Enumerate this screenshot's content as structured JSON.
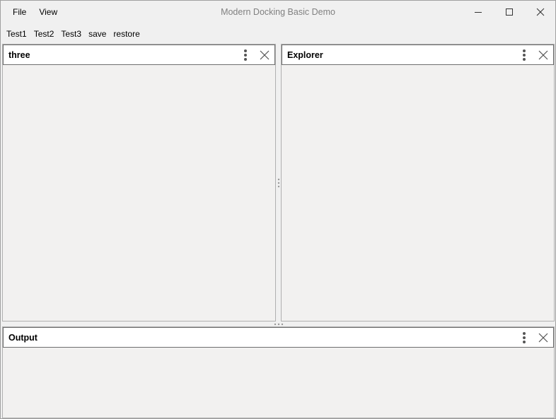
{
  "window": {
    "title": "Modern Docking Basic Demo"
  },
  "menu": {
    "file": "File",
    "view": "View"
  },
  "toolbar": {
    "test1": "Test1",
    "test2": "Test2",
    "test3": "Test3",
    "save": "save",
    "restore": "restore"
  },
  "panels": {
    "three": {
      "title": "three"
    },
    "explorer": {
      "title": "Explorer"
    },
    "output": {
      "title": "Output"
    }
  },
  "icons": {
    "minimize": "minimize-icon",
    "maximize": "maximize-icon",
    "close": "close-icon",
    "panel_menu": "vertical-dots-icon",
    "splitter": "grip-dots-icon"
  },
  "colors": {
    "background": "#f0f0f0",
    "panel_body": "#f2f1f0",
    "header_bg": "#ffffff",
    "title_text": "#808080",
    "icon": "#555555"
  }
}
